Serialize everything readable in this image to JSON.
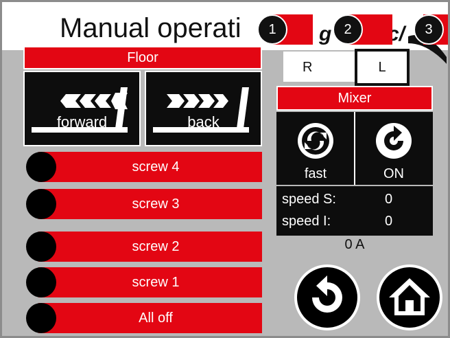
{
  "header": {
    "title": "Manual operati",
    "logo_fragment_1": "g",
    "logo_fragment_2": "c/",
    "steps": [
      "1",
      "2",
      "3"
    ]
  },
  "floor": {
    "header": "Floor",
    "forward_label": "forward",
    "back_label": "back"
  },
  "screws": [
    {
      "label": "screw 4"
    },
    {
      "label": "screw 3"
    },
    {
      "label": "screw 2"
    },
    {
      "label": "screw 1"
    },
    {
      "label": "All off"
    }
  ],
  "side_select": {
    "r_label": "R",
    "l_label": "L"
  },
  "mixer": {
    "header": "Mixer",
    "speed_mode_label": "fast",
    "power_label": "ON",
    "speed_s_label": "speed S:",
    "speed_s_value": "0",
    "speed_i_label": "speed I:",
    "speed_i_value": "0",
    "current": "0 A"
  },
  "colors": {
    "accent_red": "#e30613",
    "panel_black": "#0d0d0d",
    "background_grey": "#b9b9b9"
  },
  "icons": {
    "forward": "left-arrows-icon",
    "back": "right-arrows-icon",
    "fast": "gear-recycle-icon",
    "on": "refresh-icon",
    "back_nav": "return-arrow-icon",
    "home": "home-icon"
  }
}
